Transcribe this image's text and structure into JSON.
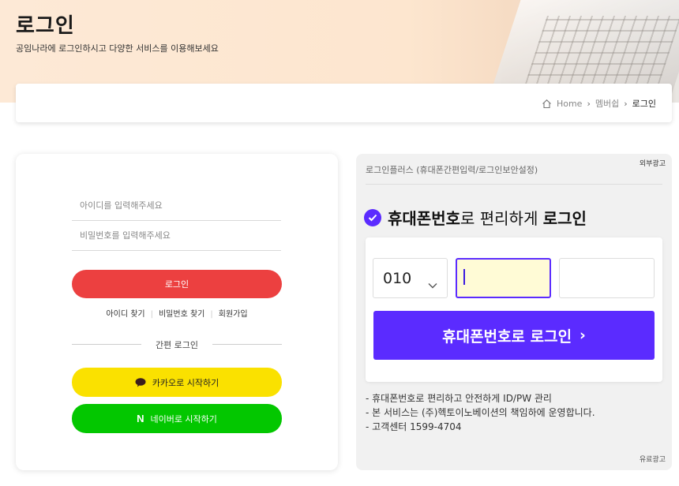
{
  "header": {
    "title": "로그인",
    "subtitle": "공임나라에 로그인하시고 다양한 서비스를 이용해보세요"
  },
  "breadcrumb": {
    "home": "Home",
    "section": "멤버쉽",
    "current": "로그인"
  },
  "login": {
    "id_placeholder": "아이디를 입력해주세요",
    "pw_placeholder": "비밀번호를 입력해주세요",
    "login_button": "로그인",
    "find_id": "아이디 찾기",
    "find_pw": "비밀번호 찾기",
    "signup": "회원가입",
    "easy_login_label": "간편 로그인",
    "kakao_button": "카카오로 시작하기",
    "naver_button": "네이버로 시작하기",
    "naver_glyph": "N"
  },
  "login_plus": {
    "ad_top": "외부광고",
    "title": "로그인플러스 (휴대폰간편입력/로그인보안설정)",
    "headline_strong1": "휴대폰번호",
    "headline_mid": "로 편리하게 ",
    "headline_strong2": "로그인",
    "phone_prefix": "010",
    "phone_button": "휴대폰번호로 로그인",
    "phone_button_arrow": "›",
    "notes": [
      "- 휴대폰번호로 편리하고 안전하게 ID/PW 관리",
      "- 본 서비스는 (주)헥토이노베이션의 책임하에 운영합니다.",
      "- 고객센터 1599-4704"
    ],
    "ad_bottom": "유료광고"
  },
  "colors": {
    "login_red": "#ec4040",
    "kakao_yellow": "#fae100",
    "naver_green": "#03c700",
    "accent_purple": "#5b2bff"
  }
}
